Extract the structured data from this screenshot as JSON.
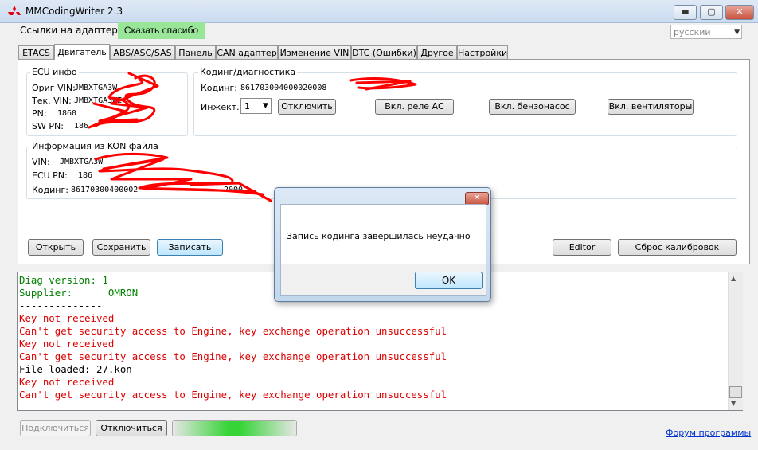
{
  "window": {
    "title": "MMCodingWriter 2.3",
    "minimize": "▬",
    "maximize": "▢",
    "close": "✕"
  },
  "topbar": {
    "links_label": "Ссылки на адаптеры",
    "thanks_button": "Сказать спасибо",
    "language": "русский"
  },
  "tabs": [
    "ETACS",
    "Двигатель",
    "ABS/ASC/SAS",
    "Панель",
    "CAN адаптер",
    "Изменение VIN",
    "DTC (Ошибки)",
    "Другое",
    "Настройки"
  ],
  "ecu_info": {
    "title": "ECU инфо",
    "orig_vin_label": "Ориг VIN:",
    "orig_vin_value": "JMBXTGA3W",
    "cur_vin_label": "Тек. VIN:",
    "cur_vin_value": "JMBXTGA3WE",
    "pn_label": "PN:",
    "pn_value": "1860",
    "swpn_label": "SW PN:",
    "swpn_value": "186"
  },
  "coding": {
    "title": "Кодинг/диагностика",
    "coding_label": "Кодинг:",
    "coding_value": "861703004000020008",
    "injector_label": "Инжект.:",
    "injector_value": "1",
    "disable_button": "Отключить",
    "ac_relay_button": "Вкл. реле АС",
    "fuel_pump_button": "Вкл. бензонасос",
    "fans_button": "Вкл. вентиляторы"
  },
  "kon_info": {
    "title": "Информация из KON файла",
    "vin_label": "VIN:",
    "vin_value": "JMBXTGA3W",
    "ecupn_label": "ECU PN:",
    "ecupn_value": "186",
    "coding_label": "Кодинг:",
    "coding_value": "86170300400002",
    "coding_tail": "2000"
  },
  "actions": {
    "open": "Открыть",
    "save": "Сохранить",
    "write": "Записать",
    "editor": "Editor",
    "reset_calib": "Сброс калибровок"
  },
  "log": [
    {
      "text": "Diag version: 1",
      "color": "#008000"
    },
    {
      "text": "Supplier:      OMRON",
      "color": "#008000"
    },
    {
      "text": "--------------",
      "color": "#000000"
    },
    {
      "text": "Key not received",
      "color": "#dd0000"
    },
    {
      "text": "Can't get security access to Engine, key exchange operation unsuccessful",
      "color": "#dd0000"
    },
    {
      "text": "Key not received",
      "color": "#dd0000"
    },
    {
      "text": "Can't get security access to Engine, key exchange operation unsuccessful",
      "color": "#dd0000"
    },
    {
      "text": "File loaded: 27.kon",
      "color": "#000000"
    },
    {
      "text": "Key not received",
      "color": "#dd0000"
    },
    {
      "text": "Can't get security access to Engine, key exchange operation unsuccessful",
      "color": "#dd0000"
    }
  ],
  "bottom": {
    "connect": "Подключиться",
    "disconnect": "Отключиться",
    "forum_link": "Форум программы"
  },
  "dialog": {
    "message": "Запись кодинга завершилась неудачно",
    "ok_button": "OK",
    "close": "✕"
  },
  "colors": {
    "accent_green": "#99e699",
    "scribble": "#ff0000",
    "progress": "#37d437"
  }
}
